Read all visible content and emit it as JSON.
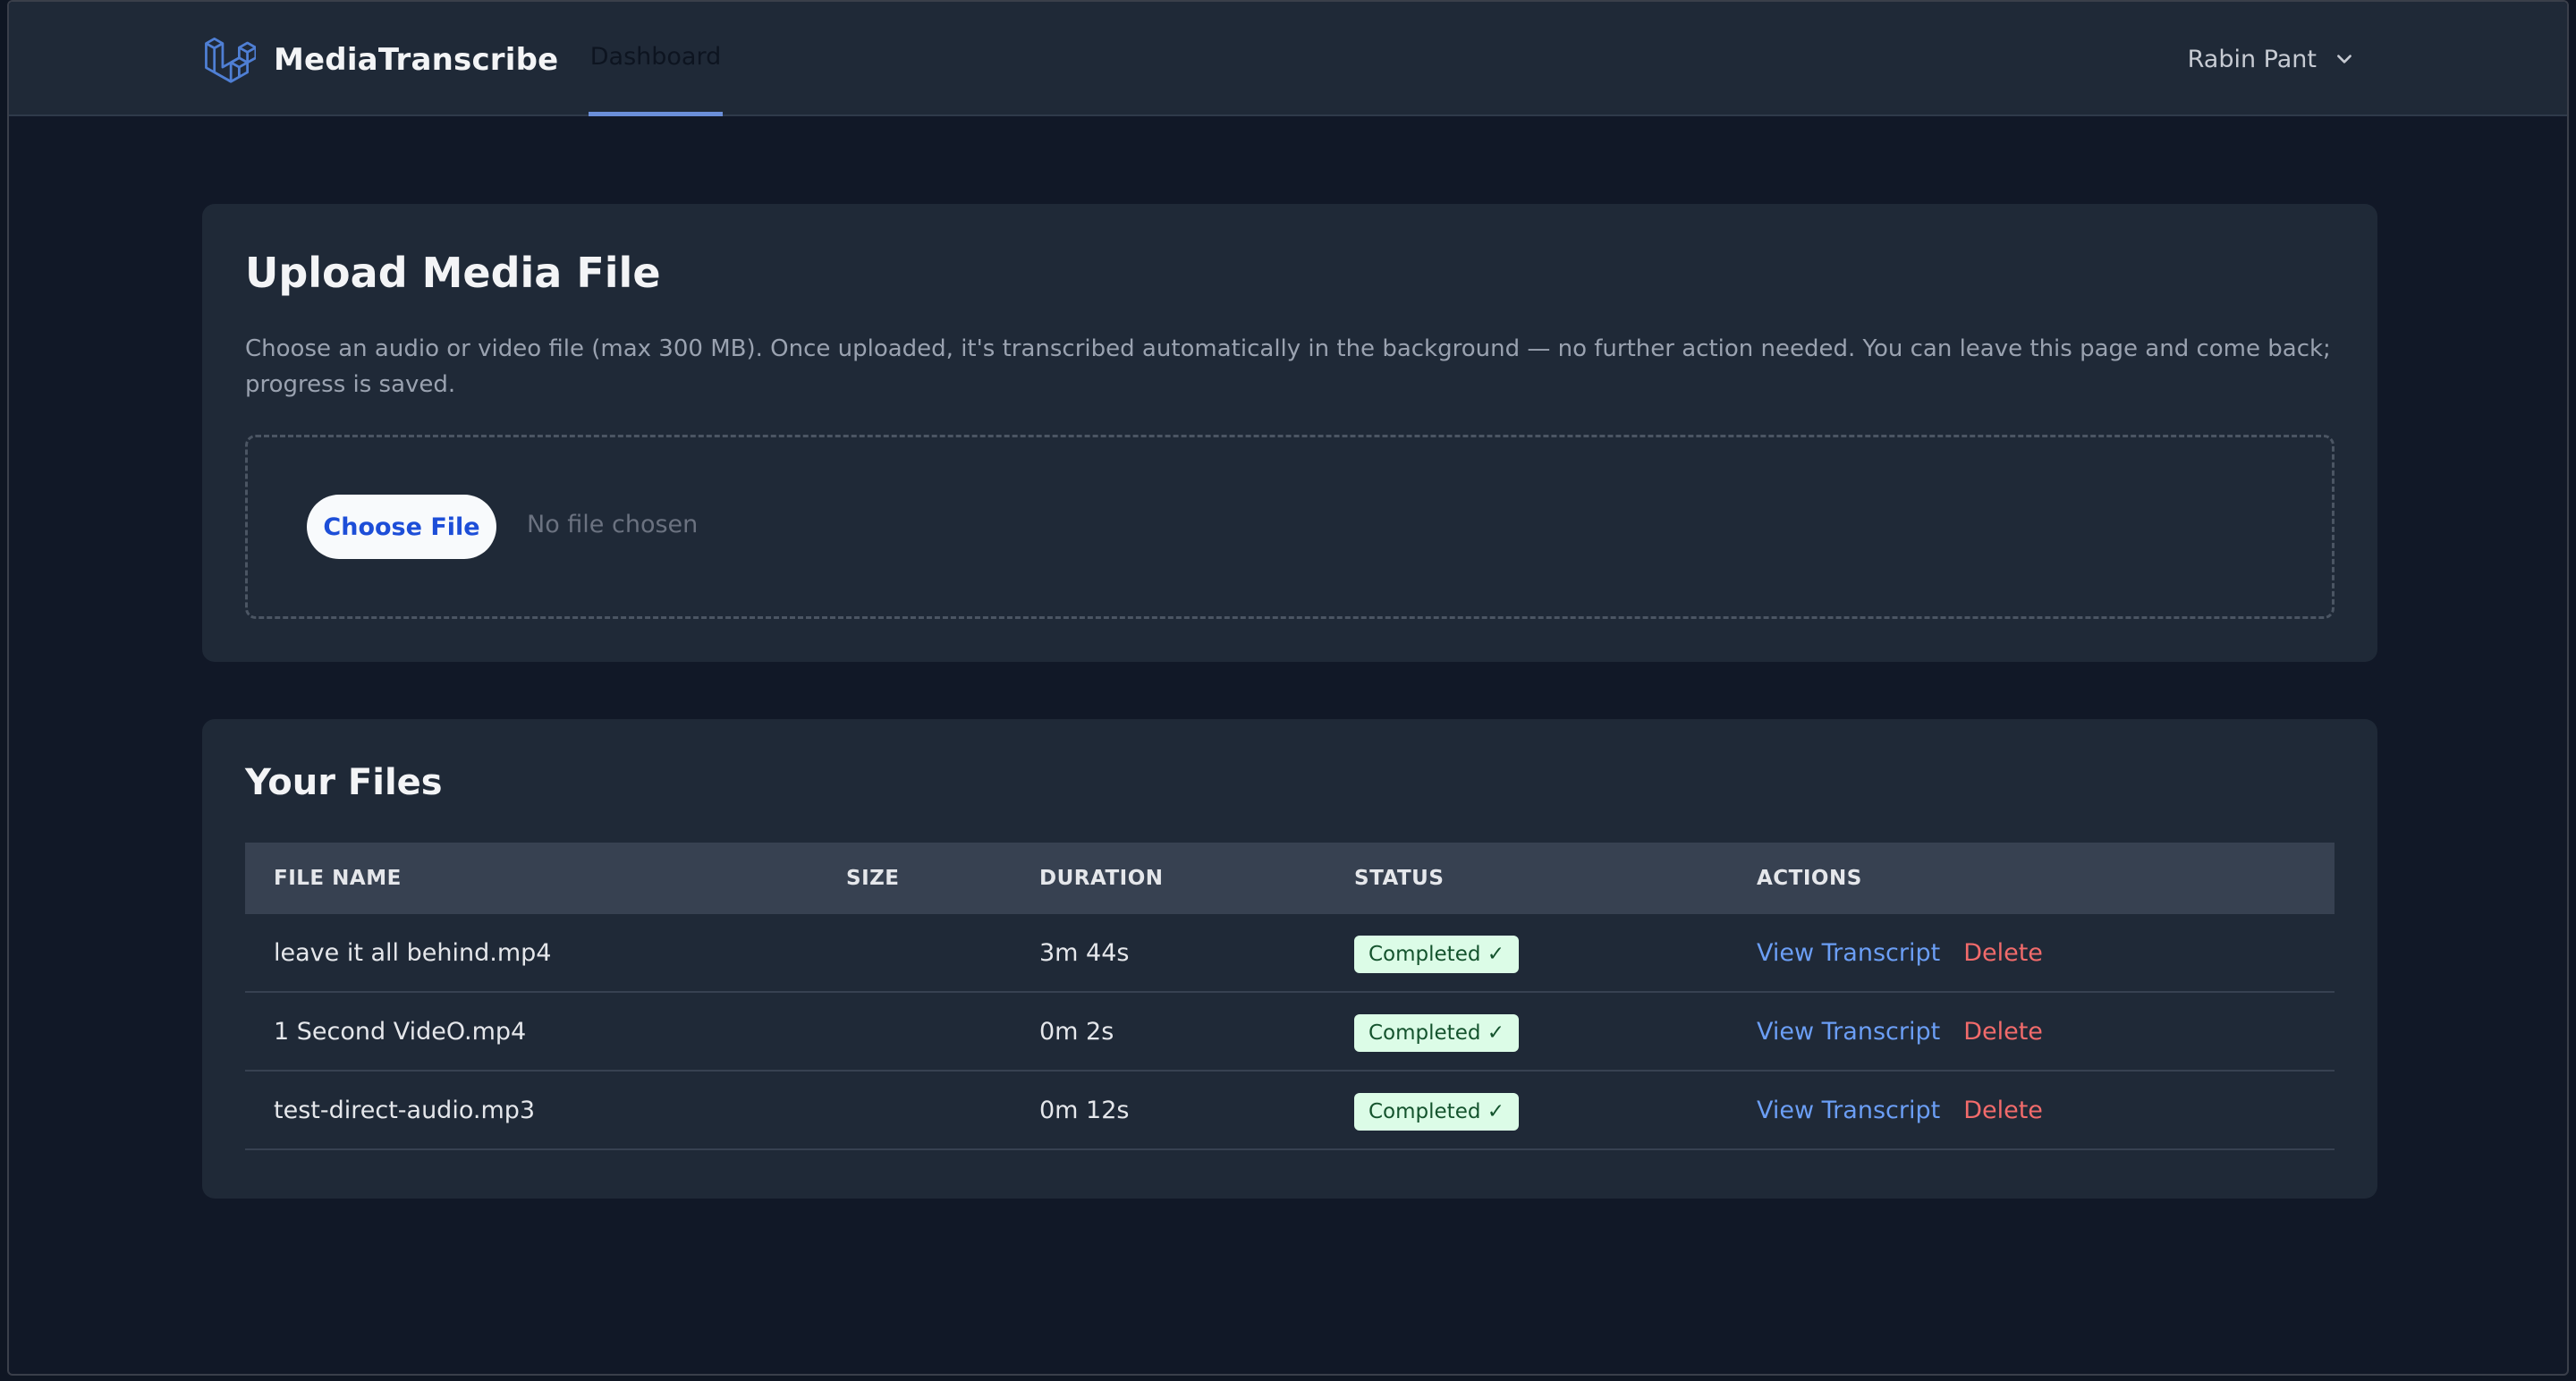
{
  "header": {
    "brand_name": "MediaTranscribe",
    "nav_tab": "Dashboard",
    "user_name": "Rabin Pant"
  },
  "upload": {
    "title": "Upload Media File",
    "description": "Choose an audio or video file (max 300 MB). Once uploaded, it's transcribed automatically in the background — no further action needed. You can leave this page and come back; progress is saved.",
    "choose_button": "Choose File",
    "no_file_text": "No file chosen"
  },
  "files": {
    "title": "Your Files",
    "columns": [
      "FILE NAME",
      "SIZE",
      "DURATION",
      "STATUS",
      "ACTIONS"
    ],
    "rows": [
      {
        "name": "leave it all behind.mp4",
        "size": "",
        "duration": "3m 44s",
        "status": "Completed ✓",
        "view": "View Transcript",
        "delete": "Delete"
      },
      {
        "name": "1 Second VideO.mp4",
        "size": "",
        "duration": "0m 2s",
        "status": "Completed ✓",
        "view": "View Transcript",
        "delete": "Delete"
      },
      {
        "name": "test-direct-audio.mp3",
        "size": "",
        "duration": "0m 12s",
        "status": "Completed ✓",
        "view": "View Transcript",
        "delete": "Delete"
      }
    ]
  },
  "icons": {
    "logo": "laravel-logo-icon",
    "user_menu": "chevron-down-icon"
  },
  "colors": {
    "accent": "#6b8fd9",
    "link": "#6b9ef5",
    "danger": "#f26b6b",
    "success_bg": "#dcfce7",
    "success_text": "#14532d"
  }
}
